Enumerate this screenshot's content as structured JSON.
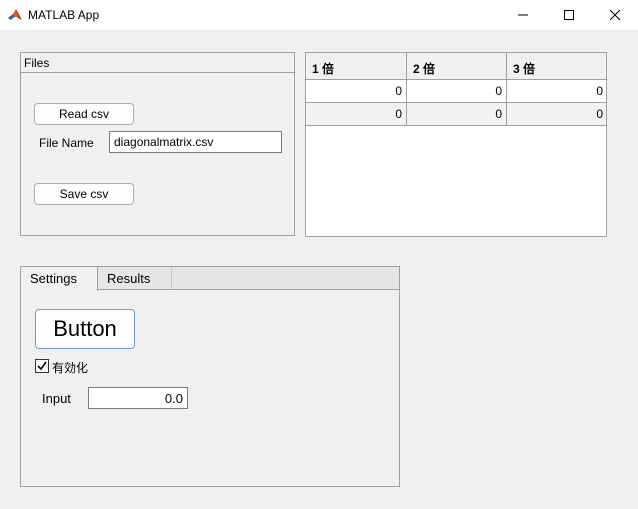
{
  "window": {
    "title": "MATLAB App",
    "icon": "matlab-logo-icon",
    "controls": [
      "minimize-icon",
      "maximize-icon",
      "close-icon"
    ]
  },
  "files_panel": {
    "title": "Files",
    "read_button": "Read csv",
    "file_name_label": "File Name",
    "file_name_value": "diagonalmatrix.csv",
    "save_button": "Save csv"
  },
  "table": {
    "columns": [
      "1 倍",
      "2 倍",
      "3 倍"
    ],
    "rows": [
      [
        "0",
        "0",
        "0"
      ],
      [
        "0",
        "0",
        "0"
      ]
    ]
  },
  "tabs": {
    "items": [
      {
        "label": "Settings",
        "selected": true
      },
      {
        "label": "Results",
        "selected": false
      }
    ],
    "button_label": "Button",
    "checkbox_label": "有効化",
    "checkbox_checked": true,
    "input_label": "Input",
    "input_value": "0.0"
  }
}
